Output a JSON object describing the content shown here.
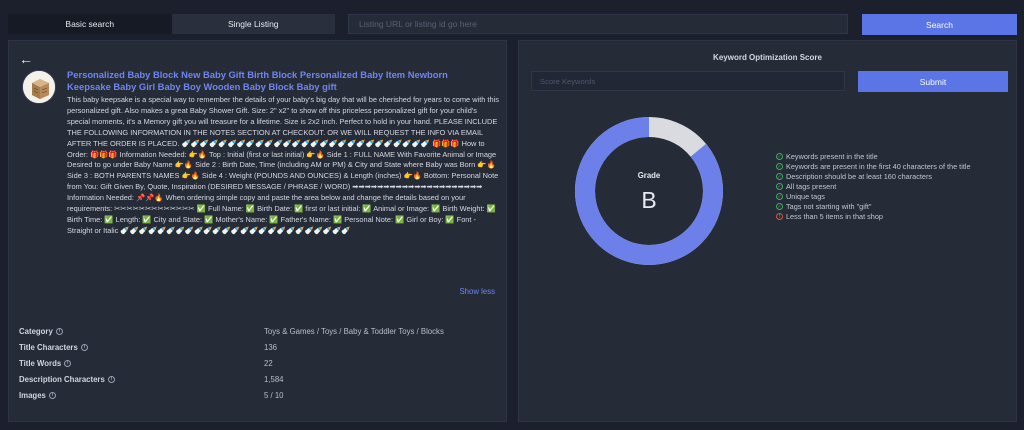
{
  "tabs": {
    "basic": "Basic search",
    "single": "Single Listing"
  },
  "search": {
    "placeholder": "Listing URL or listing id go here",
    "button": "Search"
  },
  "listing": {
    "title": "Personalized Baby Block New Baby Gift Birth Block Personalized Baby Item Newborn Keepsake Baby Girl Baby Boy Wooden Baby Block Baby gift",
    "description": "This baby keepsake is a special way to remember the details of your baby's big day that will be cherished for years to come with this personalized gift. Also makes a great Baby Shower Gift. Size: 2\" x2\" to show off this priceless personalized gift for your child's special moments, it's a Memory gift you will treasure for a lifetime. Size is 2x2 inch. Perfect to hold in your hand. PLEASE INCLUDE THE FOLLOWING INFORMATION IN THE NOTES SECTION AT CHECKOUT. OR WE WILL REQUEST THE INFO VIA EMAIL AFTER THE ORDER IS PLACED. 🍼🍼🍼🍼🍼🍼🍼🍼🍼🍼🍼🍼🍼🍼🍼🍼🍼🍼🍼🍼🍼🍼🍼🍼🍼🍼🍼 🎁🎁🎁 How to Order: 🎁🎁🎁 Information Needed: 👉🔥 Top : Initial (first or last initial) 👉🔥 Side 1 : FULL NAME With Favorite Animal or Image Desired to go under Baby Name 👉🔥 Side 2 : Birth Date, Time (including AM or PM) & City and State where Baby was Born 👉🔥 Side 3 : BOTH PARENTS NAMES 👉🔥 Side 4 : Weight (POUNDS AND OUNCES) & Length (inches) 👉🔥 Bottom: Personal Note from You: Gift Given By, Quote, Inspiration (DESIRED MESSAGE / PHRASE / WORD) ➡➡➡➡➡➡➡➡➡➡➡➡➡➡➡➡➡➡➡➡➡ Information Needed: 📌📌🔥 When ordering simple copy and paste the area below and change the details based on your requirements: ✂✂✂✂✂✂✂✂✂✂✂✂✂ ✅ Full Name: ✅ Birth Date: ✅ first or last initial: ✅ Animal or Image: ✅ Birth Weight: ✅ Birth Time: ✅ Length: ✅ City and State: ✅ Mother's Name: ✅ Father's Name: ✅ Personal Note: ✅ Girl or Boy: ✅ Font - Straight or Italic 🍼🍼🍼🍼🍼🍼🍼🍼🍼🍼🍼🍼🍼🍼🍼🍼🍼🍼🍼🍼🍼🍼🍼🍼🍼",
    "show_less": "Show less",
    "stats": [
      {
        "label": "Category",
        "value": "Toys & Games / Toys / Baby & Toddler Toys / Blocks"
      },
      {
        "label": "Title Characters",
        "value": "136"
      },
      {
        "label": "Title Words",
        "value": "22"
      },
      {
        "label": "Description Characters",
        "value": "1,584"
      },
      {
        "label": "Images",
        "value": "5 / 10"
      }
    ]
  },
  "score": {
    "title": "Keyword Optimization Score",
    "input_placeholder": "Score Keywords",
    "submit": "Submit",
    "grade_label": "Grade",
    "grade": "B",
    "score_fraction": 0.86,
    "colors": {
      "fill": "#6d80ea",
      "track": "#d9dbe0",
      "ok": "#3fae5a",
      "warn": "#e0533d"
    },
    "checks": [
      {
        "text": "Keywords present in the title",
        "status": "ok"
      },
      {
        "text": "Keywords are present in the first 40 characters of the title",
        "status": "ok"
      },
      {
        "text": "Description should be at least 160 characters",
        "status": "ok"
      },
      {
        "text": "All tags present",
        "status": "ok"
      },
      {
        "text": "Unique tags",
        "status": "ok"
      },
      {
        "text": "Tags not starting with \"gift\"",
        "status": "ok"
      },
      {
        "text": "Less than 5 items in that shop",
        "status": "warn"
      }
    ]
  }
}
